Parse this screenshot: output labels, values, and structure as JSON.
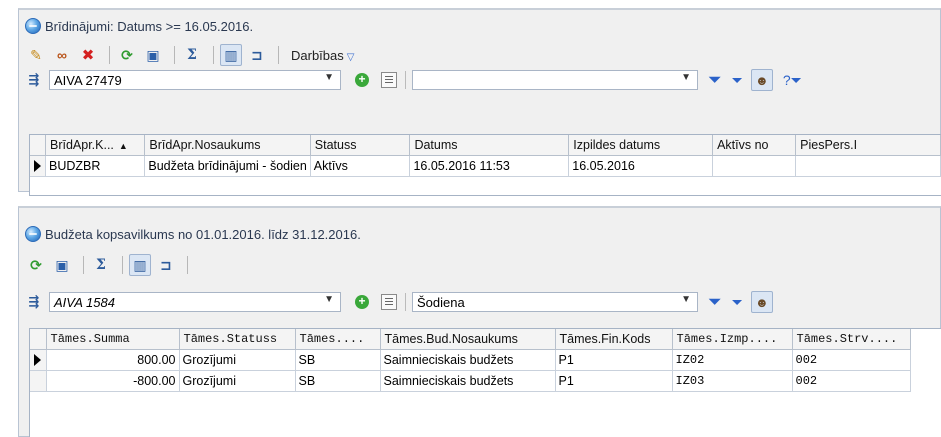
{
  "top_panel": {
    "title": "Brīdinājumi: Datums >= 16.05.2016.",
    "toolbar": {
      "actions_label": "Darbības"
    },
    "filter": {
      "combo_value": "AIVA 27479",
      "second_combo_value": ""
    },
    "grid": {
      "columns": [
        "BrīdApr.K...",
        "BrīdApr.Nosaukums",
        "Statuss",
        "Datums",
        "Izpildes datums",
        "Aktīvs no",
        "PiesPers.I"
      ],
      "sort_column": 0,
      "rows": [
        [
          "BUDZBR",
          "Budžeta brīdinājumi - šodien",
          "Aktīvs",
          "16.05.2016 11:53",
          "16.05.2016",
          "",
          ""
        ]
      ]
    }
  },
  "bottom_panel": {
    "title": "Budžeta kopsavilkums no 01.01.2016. līdz 31.12.2016.",
    "filter": {
      "combo_value": "AIVA 1584",
      "second_combo_value": "Šodiena"
    },
    "grid": {
      "columns": [
        "Tāmes.Summa",
        "Tāmes.Statuss",
        "Tāmes....",
        "Tāmes.Bud.Nosaukums",
        "Tāmes.Fin.Kods",
        "Tāmes.Izmp....",
        "Tāmes.Strv...."
      ],
      "rows": [
        [
          "800.00",
          "Grozījumi",
          "SB",
          "Saimnieciskais budžets",
          "P1",
          "IZ02",
          "002"
        ],
        [
          "-800.00",
          "Grozījumi",
          "SB",
          "Saimnieciskais budžets",
          "P1",
          "IZ03",
          "002"
        ]
      ]
    }
  },
  "icons": {
    "edit": "pencil-icon",
    "view": "glasses-icon",
    "delete": "delete-x-icon",
    "refresh": "refresh-icon",
    "print": "print-icon",
    "sum": "sigma-icon",
    "columns": "columns-icon",
    "tree": "tree-icon",
    "filter": "funnel-icon",
    "person": "person-icon"
  },
  "colors": {
    "panel_bg": "#f0f0f0",
    "accent_blue": "#2b62c9",
    "green_add": "#3aa83a",
    "delete_red": "#d42020"
  }
}
